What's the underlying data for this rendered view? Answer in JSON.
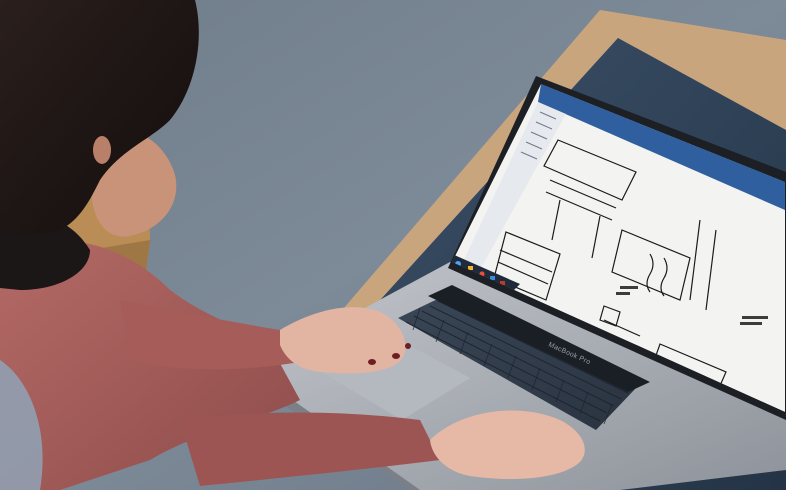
{
  "scene": {
    "laptop": {
      "brand_label": "MacBook Pro"
    },
    "screen": {
      "app": "cad-viewer",
      "taskbar_icons": [
        "start-icon",
        "folder-icon",
        "browser-icon",
        "mail-icon",
        "cad-app-icon"
      ]
    },
    "colors": {
      "carpet": "#7a8795",
      "table_wood": "#c9a57e",
      "table_top": "#2f4257",
      "laptop_body": "#a9adb4",
      "keyboard": "#323d4b",
      "screen_bg": "#f3f3f1",
      "ribbon": "#2f5f9e",
      "sweater": "#a65d5a",
      "chair": "#b98d55"
    }
  }
}
